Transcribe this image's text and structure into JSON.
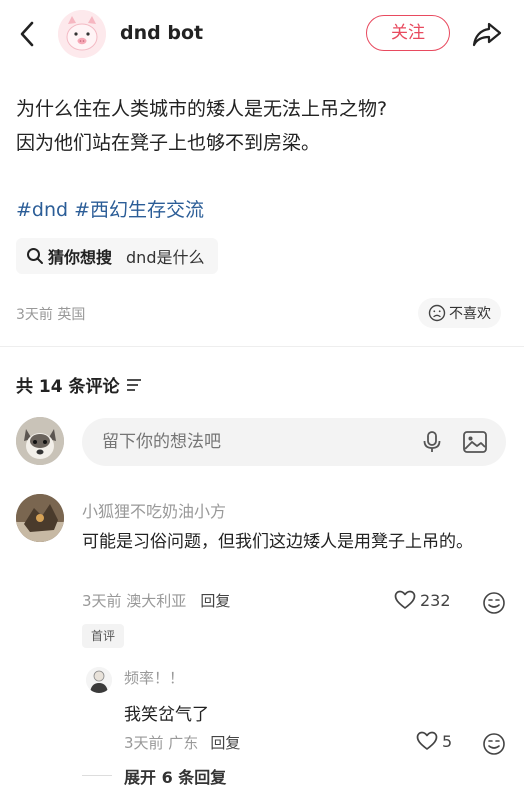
{
  "header": {
    "author_name": "dnd bot",
    "follow_label": "关注",
    "icons": {
      "back": "chevron-left-icon",
      "share": "share-arrow-icon"
    }
  },
  "post": {
    "lines": [
      "为什么住在人类城市的矮人是无法上吊之物?",
      "因为他们站在凳子上也够不到房梁。"
    ],
    "tags": [
      "#dnd",
      "#西幻生存交流"
    ],
    "search_suggestion": {
      "label": "猜你想搜",
      "term": "dnd是什么"
    },
    "meta": "3天前 英国",
    "dislike_label": "不喜欢"
  },
  "comments_section": {
    "count_label": "共 14 条评论",
    "input_placeholder": "留下你的想法吧"
  },
  "comments": [
    {
      "name": "小狐狸不吃奶油小方",
      "text": "可能是习俗问题，但我们这边矮人是用凳子上吊的。",
      "time_location": "3天前 澳大利亚",
      "reply_label": "回复",
      "likes": "232",
      "badge": "首评",
      "replies": [
        {
          "name": "频率！！",
          "text": "我笑岔气了",
          "time_location": "3天前 广东",
          "reply_label": "回复",
          "likes": "5"
        }
      ],
      "expand_label": "展开 6 条回复"
    }
  ],
  "colors": {
    "accent": "#e84a5f",
    "tag": "#2b5d97",
    "muted": "#999999"
  }
}
